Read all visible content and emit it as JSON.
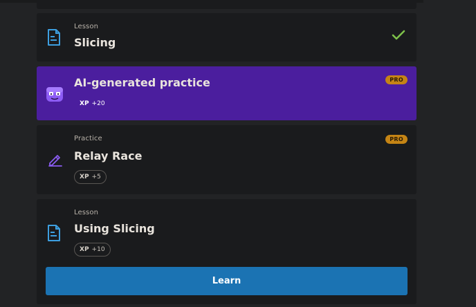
{
  "lessons": [
    {
      "kind": "Lesson",
      "title": "Slicing",
      "completed": true,
      "icon": "lesson-doc-icon"
    },
    {
      "kind": "",
      "title": "AI-generated practice",
      "xp_label": "XP",
      "xp_value": "+20",
      "badge": "PRO",
      "icon": "robot-mascot-icon",
      "highlight_color": "#4b1e9e"
    },
    {
      "kind": "Practice",
      "title": "Relay Race",
      "xp_label": "XP",
      "xp_value": "+5",
      "badge": "PRO",
      "icon": "pencil-edit-icon"
    },
    {
      "kind": "Lesson",
      "title": "Using Slicing",
      "xp_label": "XP",
      "xp_value": "+10",
      "icon": "lesson-doc-icon",
      "action_label": "Learn"
    }
  ],
  "colors": {
    "accent_blue": "#1b73b3",
    "pro_badge": "#c58415",
    "check_green": "#7ec24a",
    "icon_blue": "#3d9fe0",
    "icon_purple": "#8a5cf0"
  }
}
